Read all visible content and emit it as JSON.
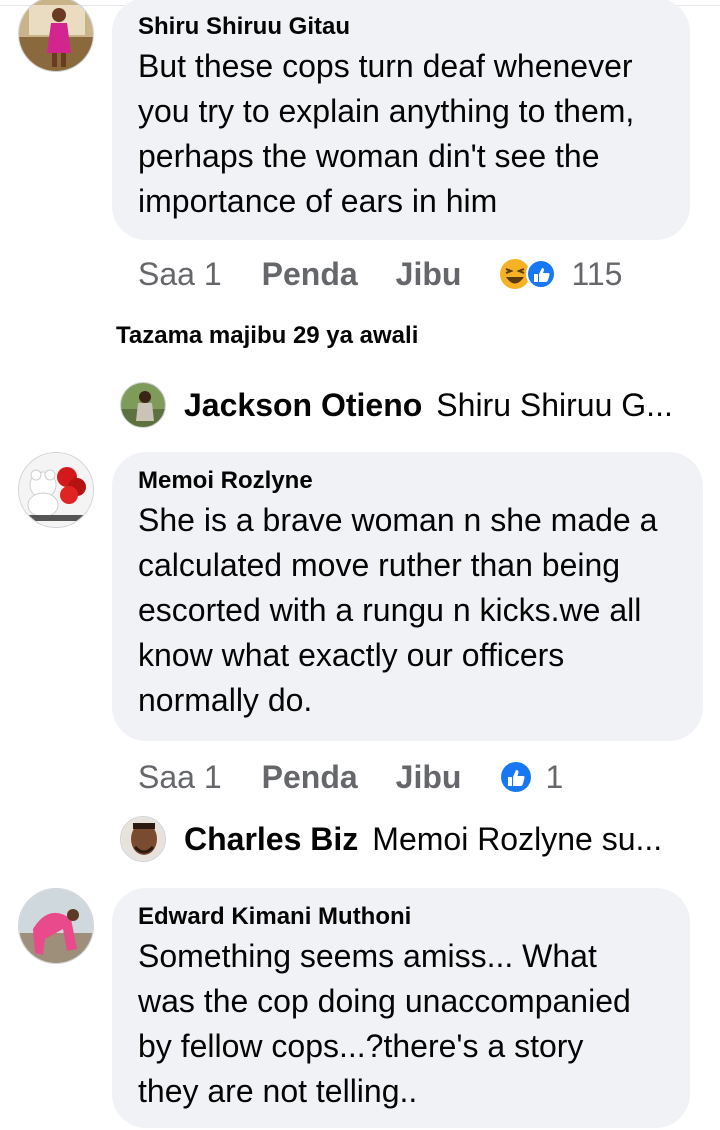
{
  "comments": [
    {
      "author": "Shiru Shiruu Gitau",
      "text": "But these cops turn deaf whenever\nyou try to explain anything to them,\nperhaps the woman din't see the\nimportance of ears in him",
      "time": "Saa 1",
      "like_label": "Penda",
      "reply_label": "Jibu",
      "reactions": [
        "haha",
        "like"
      ],
      "reaction_count": "115"
    },
    {
      "author": "Memoi Rozlyne",
      "text": "She is a brave woman n she made a\ncalculated move ruther than being\nescorted with a rungu n kicks.we all\nknow what exactly our officers\nnormally do.",
      "time": "Saa 1",
      "like_label": "Penda",
      "reply_label": "Jibu",
      "reactions": [
        "like"
      ],
      "reaction_count": "1"
    },
    {
      "author": "Edward Kimani Muthoni",
      "text": "Something seems amiss... What\nwas the cop doing unaccompanied\nby fellow cops...?there's a story\nthey are not telling.."
    }
  ],
  "view_previous": "Tazama majibu 29 ya awali",
  "replies": [
    {
      "name": "Jackson Otieno",
      "preview": "Shiru Shiruu G..."
    },
    {
      "name": "Charles Biz",
      "preview": "Memoi Rozlyne su..."
    }
  ],
  "colors": {
    "bubble": "#f0f2f5",
    "meta": "#65676b",
    "like_blue": "#1877f2",
    "haha_yellow": "#f7b125"
  }
}
